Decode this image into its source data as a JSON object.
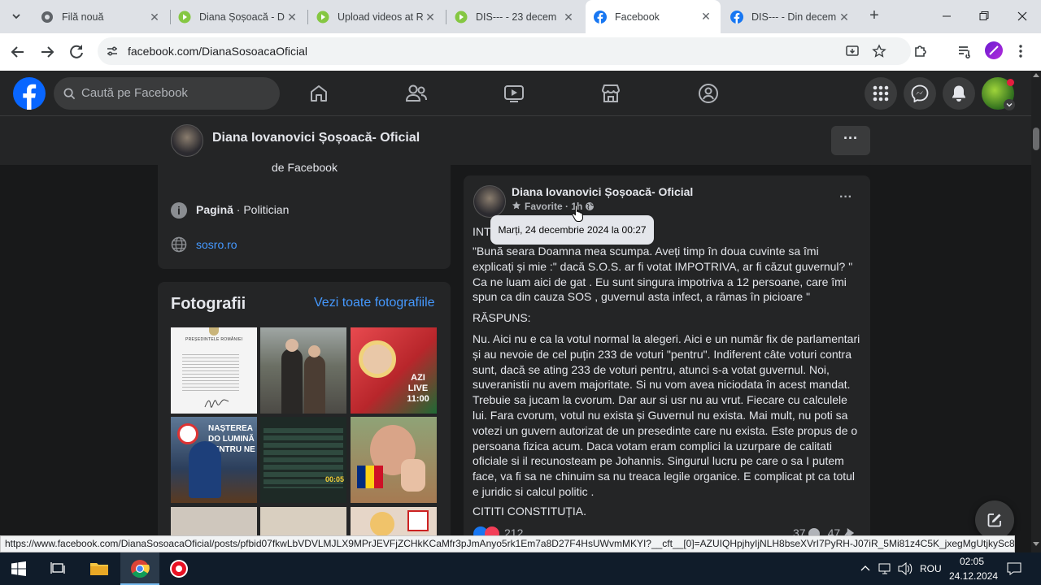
{
  "browser": {
    "tabs": [
      {
        "title": "Filă nouă",
        "icon": "chrome-icon"
      },
      {
        "title": "Diana Șoșoacă - D",
        "icon": "rumble-icon"
      },
      {
        "title": "Upload videos at R",
        "icon": "rumble-icon"
      },
      {
        "title": "DIS--- - 23 decem",
        "icon": "rumble-icon"
      },
      {
        "title": "Facebook",
        "icon": "facebook-icon"
      },
      {
        "title": "DIS--- - Din decem",
        "icon": "facebook-icon"
      }
    ],
    "url": "facebook.com/DianaSosoacaOficial",
    "status_url": "https://www.facebook.com/DianaSosoacaOficial/posts/pfbid07fkwLbVDVLMJLX9MPrJEVFjZCHkKCaMfr3pJmAnyo5rk1Em7a8D27F4HsUWvmMKYI?__cft__[0]=AZUIQHpjhyIjNLH8bseXVrI7PyRH-J07iR_5Mi81z4C5K_jxegMgUtjkySc8L3AV_..."
  },
  "facebook": {
    "search_placeholder": "Caută pe Facebook"
  },
  "page": {
    "name": "Diana Iovanovici Șoșoacă- Oficial",
    "intro_cut": "de Facebook",
    "category_bold": "Pagină",
    "category_rest": " · Politician",
    "website": "sosro.ro",
    "photos_title": "Fotografii",
    "photos_link": "Vezi toate fotografiile"
  },
  "post": {
    "author": "Diana Iovanovici Șoșoacă- Oficial",
    "meta_label": "Favorite · 1h",
    "tooltip": "Marți, 24 decembrie 2024 la 00:27",
    "intro": "INTR",
    "paragraphs": [
      "\"Bună seara Doamna mea scumpa. Aveți timp în doua cuvinte sa îmi explicați și mie :\" dacă S.O.S. ar fi votat IMPOTRIVA, ar fi căzut guvernul? \" Ca ne luam aici de gat . Eu sunt singura impotriva a 12 persoane, care îmi spun ca din cauza SOS , guvernul asta infect, a rămas în picioare \"",
      "RĂSPUNS:",
      "Nu. Aici nu e ca la votul normal la alegeri. Aici e un număr fix de parlamentari și au nevoie de cel puțin 233 de voturi \"pentru\". Indiferent câte voturi contra sunt, dacă se ating 233 de voturi pentru, atunci s-a votat guvernul. Noi, suveranistii nu avem majoritate.  Si nu vom avea niciodata în acest mandat. Trebuie sa jucam la cvorum. Dar aur  si usr nu au vrut. Fiecare cu calculele lui. Fara cvorum, votul nu exista și Guvernul nu exista. Mai mult, nu poti sa votezi un guvern autorizat de un presedinte care nu exista. Este propus de o persoana fizica acum. Daca votam eram complici la uzurpare de calitati oficiale si il recunosteam pe Johannis. Singurul lucru pe care o sa I putem face, va fi sa ne chinuim sa nu treaca legile organice. E complicat pt ca totul e juridic si calcul politic .",
      "CITITI CONSTITUȚIA."
    ],
    "reactions": "212",
    "comments": "37",
    "shares": "47"
  },
  "photos": [
    {
      "label": "PREȘEDINTELE ROMÂNIEI",
      "bg": "#f4f4f4"
    },
    {
      "label": "",
      "bg": "#6b6f64"
    },
    {
      "label": "AZI LIVE 11:00",
      "bg": "#b8262b"
    },
    {
      "label": "NAȘTEREA DO LUMINĂ PENTRU NE",
      "bg": "#2c3f5c"
    },
    {
      "label": "00:05",
      "bg": "#1e2a26"
    },
    {
      "label": "",
      "bg": "#a67a52"
    }
  ],
  "taskbar": {
    "lang": "ROU",
    "time": "02:05",
    "date": "24.12.2024"
  }
}
